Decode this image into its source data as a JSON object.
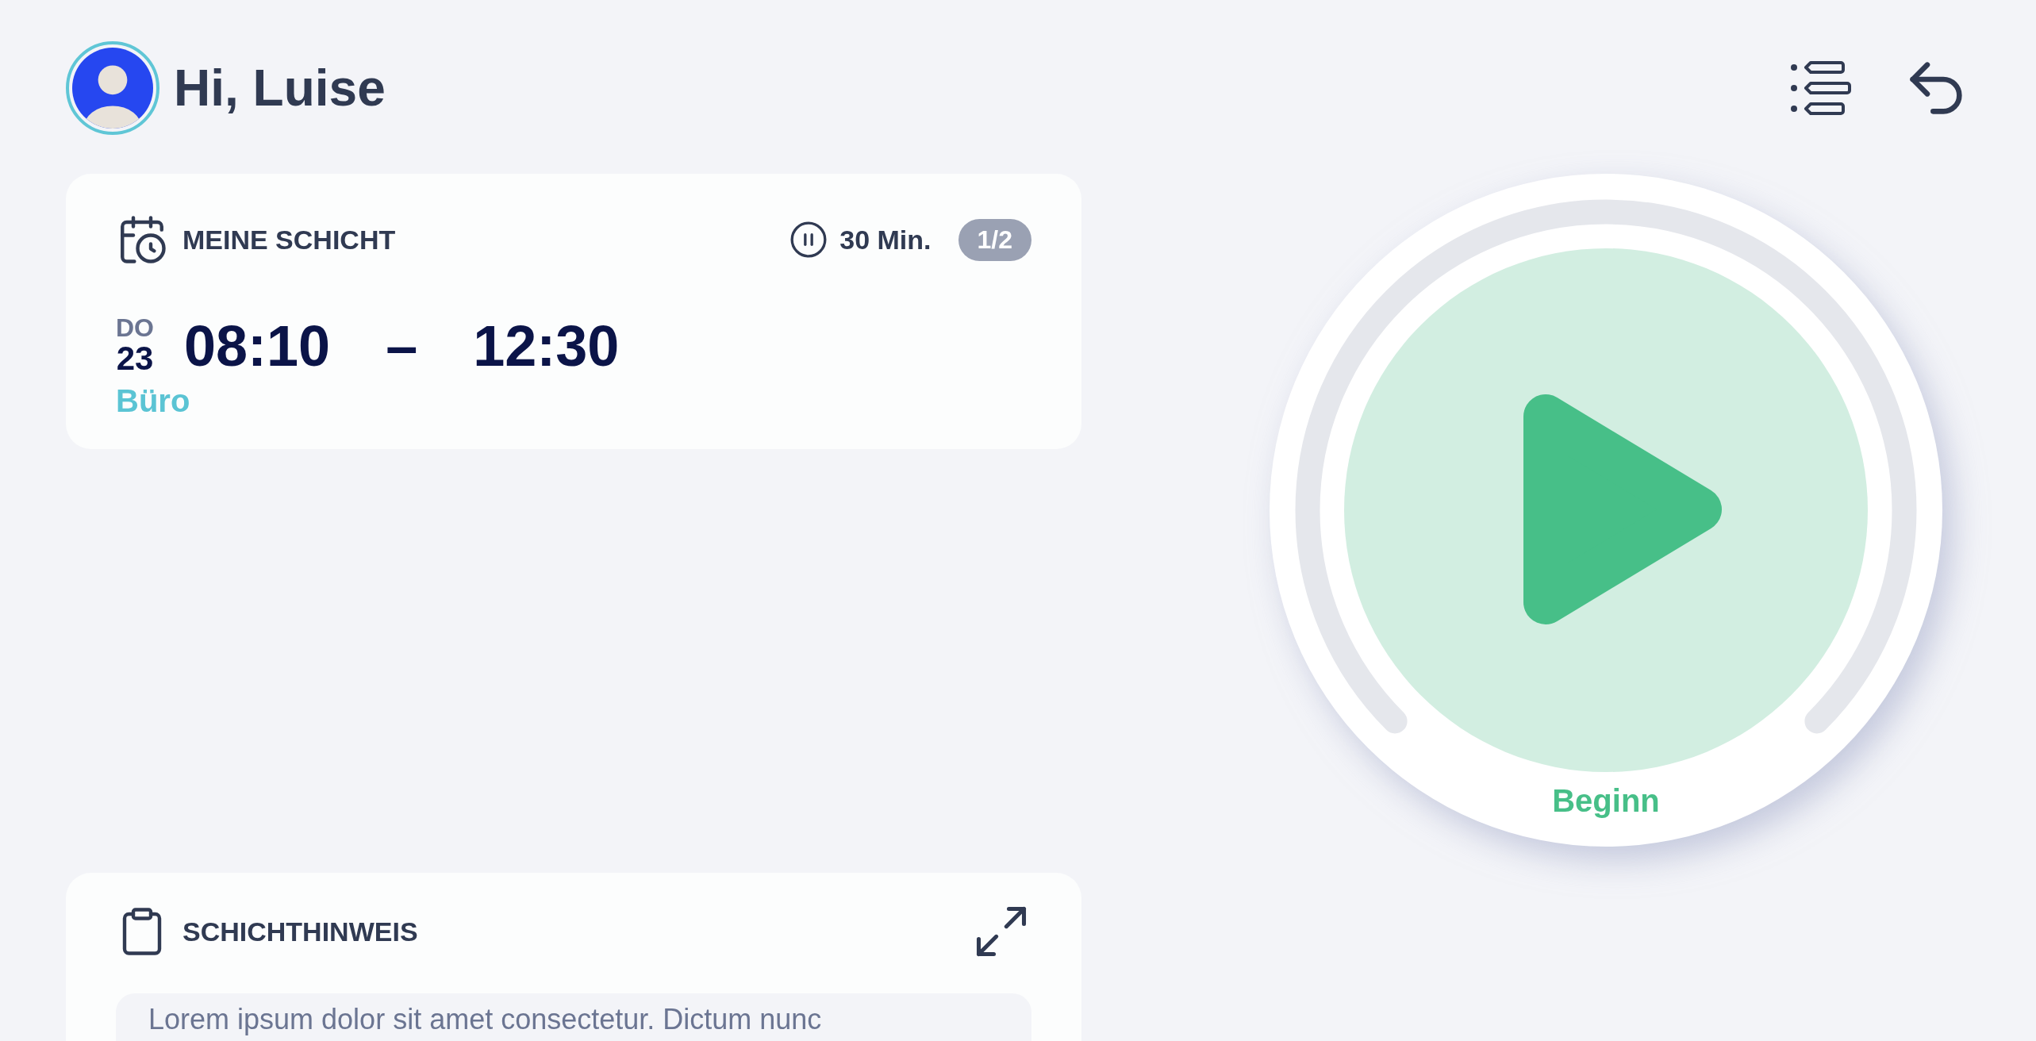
{
  "header": {
    "greeting": "Hi, Luise"
  },
  "shift_card": {
    "title": "MEINE SCHICHT",
    "break": "30 Min.",
    "badge": "1/2",
    "weekday": "DO",
    "day": "23",
    "start": "08:10",
    "separator": "–",
    "end": "12:30",
    "location": "Büro"
  },
  "note_card": {
    "title": "SCHICHTHINWEIS",
    "text": "Lorem ipsum dolor sit amet consectetur. Dictum nunc"
  },
  "start_button": {
    "label": "Beginn"
  }
}
